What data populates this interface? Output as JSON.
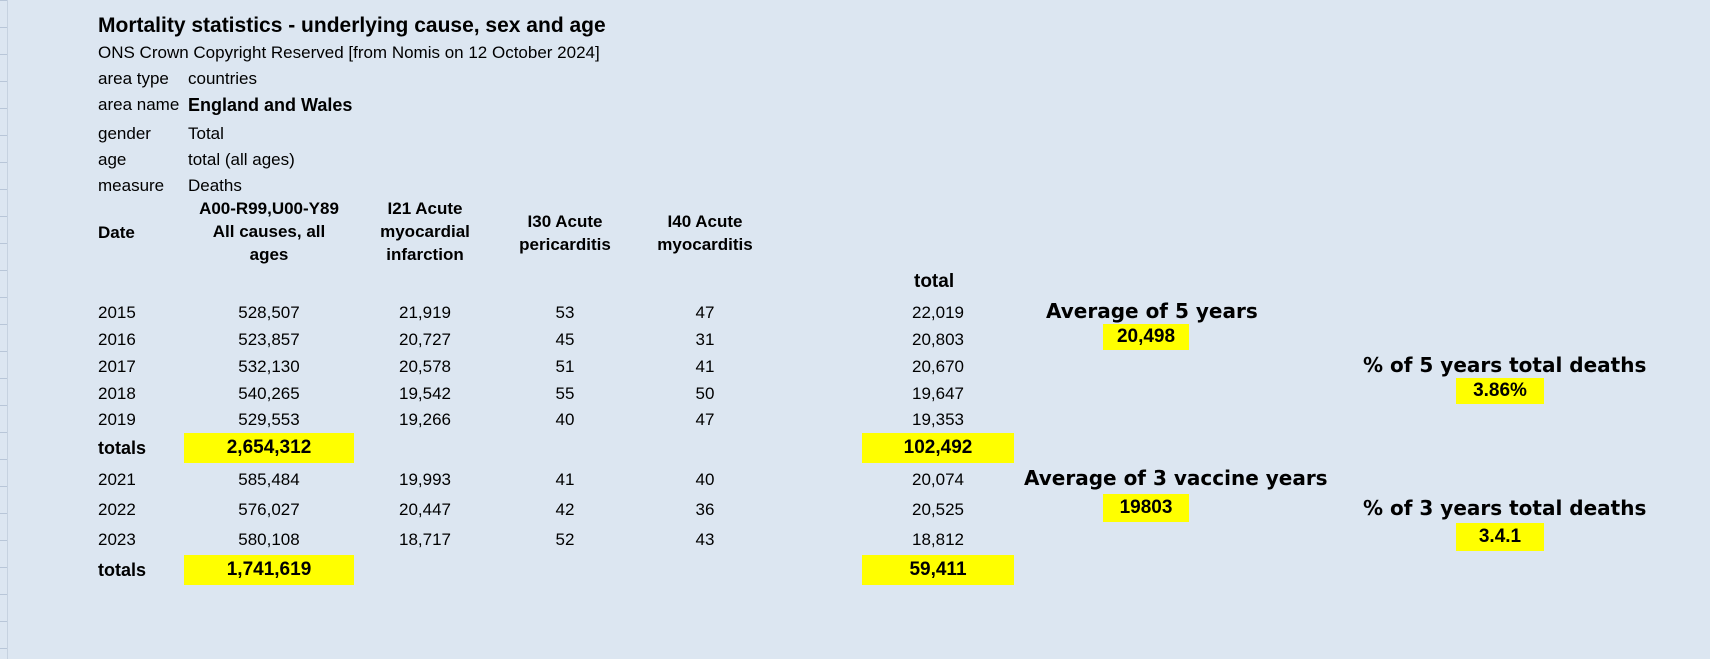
{
  "title": "Mortality statistics - underlying cause, sex and age",
  "source": "ONS Crown Copyright Reserved [from Nomis on 12 October 2024]",
  "meta": [
    {
      "label": "area type",
      "value": "countries",
      "bold": false
    },
    {
      "label": "area name",
      "value": "England and Wales",
      "bold": true
    },
    {
      "label": "gender",
      "value": "Total",
      "bold": false
    },
    {
      "label": "age",
      "value": "total (all ages)",
      "bold": false
    },
    {
      "label": "measure",
      "value": "Deaths",
      "bold": false
    }
  ],
  "headers": {
    "date": "Date",
    "all_causes": [
      "A00-R99,U00-Y89",
      "All causes, all",
      "ages"
    ],
    "i21": [
      "I21 Acute",
      "myocardial",
      "infarction"
    ],
    "i30": [
      "I30 Acute",
      "pericarditis"
    ],
    "i40": [
      "I40 Acute",
      "myocarditis"
    ],
    "total": "total"
  },
  "block1": [
    {
      "year": "2015",
      "all": "528,507",
      "i21": "21,919",
      "i30": "53",
      "i40": "47",
      "total": "22,019"
    },
    {
      "year": "2016",
      "all": "523,857",
      "i21": "20,727",
      "i30": "45",
      "i40": "31",
      "total": "20,803"
    },
    {
      "year": "2017",
      "all": "532,130",
      "i21": "20,578",
      "i30": "51",
      "i40": "41",
      "total": "20,670"
    },
    {
      "year": "2018",
      "all": "540,265",
      "i21": "19,542",
      "i30": "55",
      "i40": "50",
      "total": "19,647"
    },
    {
      "year": "2019",
      "all": "529,553",
      "i21": "19,266",
      "i30": "40",
      "i40": "47",
      "total": "19,353"
    }
  ],
  "totals1": {
    "label": "totals",
    "all": "2,654,312",
    "total": "102,492"
  },
  "block2": [
    {
      "year": "2021",
      "all": "585,484",
      "i21": "19,993",
      "i30": "41",
      "i40": "40",
      "total": "20,074"
    },
    {
      "year": "2022",
      "all": "576,027",
      "i21": "20,447",
      "i30": "42",
      "i40": "36",
      "total": "20,525"
    },
    {
      "year": "2023",
      "all": "580,108",
      "i21": "18,717",
      "i30": "52",
      "i40": "43",
      "total": "18,812"
    }
  ],
  "totals2": {
    "label": "totals",
    "all": "1,741,619",
    "total": "59,411"
  },
  "notes": {
    "avg5_label": "Average of 5 years",
    "avg5_value": "20,498",
    "pct5_label": "% of 5 years total deaths",
    "pct5_value": "3.86%",
    "avg3_label": "Average of 3 vaccine  years",
    "avg3_value": "19803",
    "pct3_label": "% of 3 years total deaths",
    "pct3_value": "3.4.1"
  },
  "colors": {
    "background": "#dce6f1",
    "highlight": "#ffff00"
  }
}
